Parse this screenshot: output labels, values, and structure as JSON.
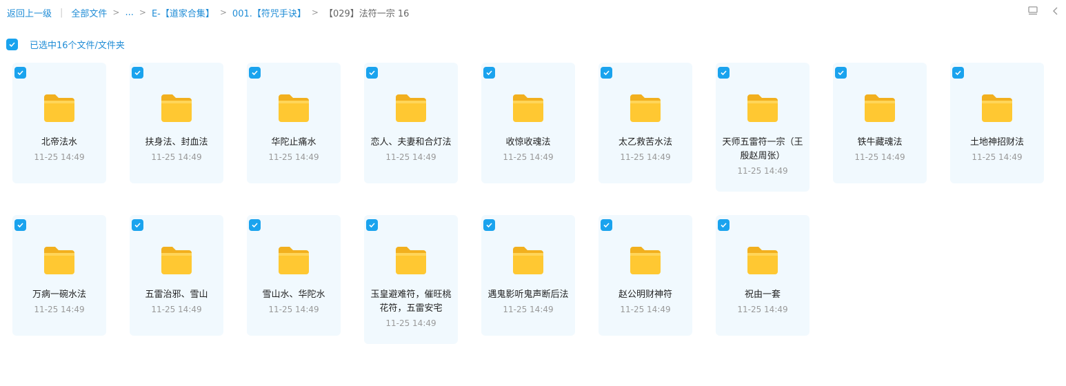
{
  "breadcrumb": {
    "back": "返回上一级",
    "root": "全部文件",
    "ellipsis": "...",
    "level1": "E-【道家合集】",
    "level2": "001.【符咒手诀】",
    "current": "【029】法符一宗 16",
    "sep": ">",
    "bar": "|"
  },
  "top_icons": [
    "list-view-icon",
    "chevron-left-icon"
  ],
  "selection": {
    "text": "已选中16个文件/文件夹",
    "checked": true
  },
  "colors": {
    "accent": "#1aa3ee",
    "link": "#1f8cd6",
    "card_bg": "#f1f9fe",
    "folder": "#ffc832"
  },
  "items": [
    {
      "name": "北帝法水",
      "time": "11-25 14:49"
    },
    {
      "name": "扶身法、封血法",
      "time": "11-25 14:49"
    },
    {
      "name": "华陀止痛水",
      "time": "11-25 14:49"
    },
    {
      "name": "恋人、夫妻和合灯法",
      "time": "11-25 14:49"
    },
    {
      "name": "收惊收魂法",
      "time": "11-25 14:49"
    },
    {
      "name": "太乙救苦水法",
      "time": "11-25 14:49"
    },
    {
      "name": "天师五雷符一宗（王殷赵周张）",
      "time": "11-25 14:49"
    },
    {
      "name": "铁牛藏魂法",
      "time": "11-25 14:49"
    },
    {
      "name": "土地神招财法",
      "time": "11-25 14:49"
    },
    {
      "name": "万病一碗水法",
      "time": "11-25 14:49"
    },
    {
      "name": "五雷治邪、雪山",
      "time": "11-25 14:49"
    },
    {
      "name": "雪山水、华陀水",
      "time": "11-25 14:49"
    },
    {
      "name": "玉皇避难符，催旺桃花符，五雷安宅",
      "time": "11-25 14:49"
    },
    {
      "name": "遇鬼影听鬼声断后法",
      "time": "11-25 14:49"
    },
    {
      "name": "赵公明财神符",
      "time": "11-25 14:49"
    },
    {
      "name": "祝由一套",
      "time": "11-25 14:49"
    }
  ]
}
